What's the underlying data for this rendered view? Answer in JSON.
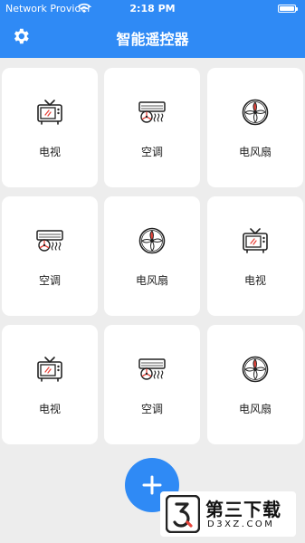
{
  "status_bar": {
    "carrier": "Network Provider",
    "time": "2:18 PM",
    "battery_level": 1.0
  },
  "header": {
    "title": "智能遥控器",
    "settings_icon": "gear-icon"
  },
  "devices": [
    {
      "label": "电视",
      "icon": "tv-icon"
    },
    {
      "label": "空调",
      "icon": "air-conditioner-icon"
    },
    {
      "label": "电风扇",
      "icon": "fan-icon"
    },
    {
      "label": "空调",
      "icon": "air-conditioner-icon"
    },
    {
      "label": "电风扇",
      "icon": "fan-icon"
    },
    {
      "label": "电视",
      "icon": "tv-icon"
    },
    {
      "label": "电视",
      "icon": "tv-icon"
    },
    {
      "label": "空调",
      "icon": "air-conditioner-icon"
    },
    {
      "label": "电风扇",
      "icon": "fan-icon"
    }
  ],
  "add_button": {
    "icon": "plus-icon"
  },
  "watermark": {
    "title": "第三下载",
    "domain": "D3XZ.COM",
    "logo": "d3xz-logo"
  },
  "colors": {
    "accent": "#2f8af5",
    "background": "#ededed",
    "card": "#ffffff",
    "icon_accent": "#e8453c"
  }
}
